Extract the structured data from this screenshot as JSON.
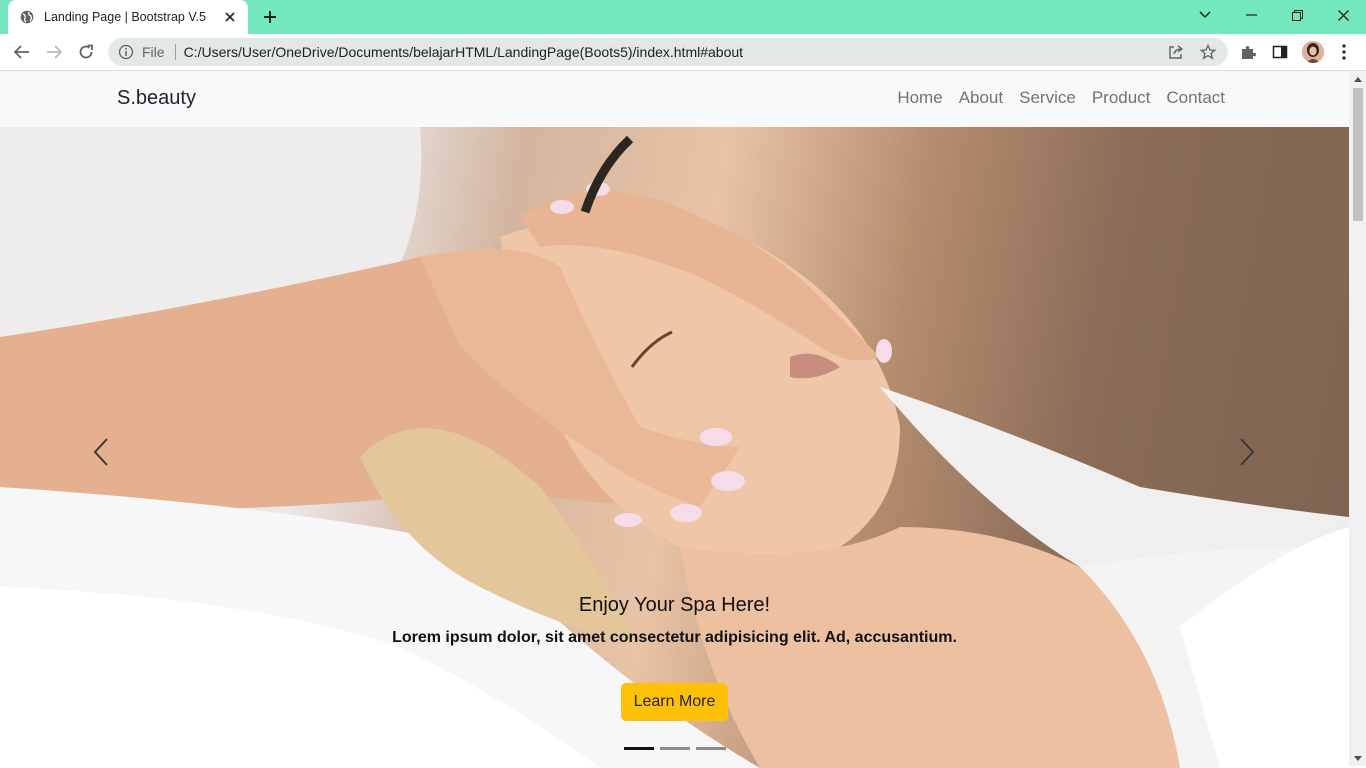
{
  "browser": {
    "tab_title": "Landing Page | Bootstrap V.5",
    "url_scheme": "File",
    "url": "C:/Users/User/OneDrive/Documents/belajarHTML/LandingPage(Boots5)/index.html#about"
  },
  "navbar": {
    "brand": "S.beauty",
    "links": [
      "Home",
      "About",
      "Service",
      "Product",
      "Contact"
    ]
  },
  "carousel": {
    "title": "Enjoy Your Spa Here!",
    "text": "Lorem ipsum dolor, sit amet consectetur adipisicing elit. Ad, accusantium.",
    "button": "Learn More",
    "slide_count": 3,
    "active_index": 0
  },
  "colors": {
    "tabbar": "#73e8bd",
    "button": "#ffc107",
    "indicator_active": "#111111",
    "indicator_inactive": "#8a8a8a"
  }
}
